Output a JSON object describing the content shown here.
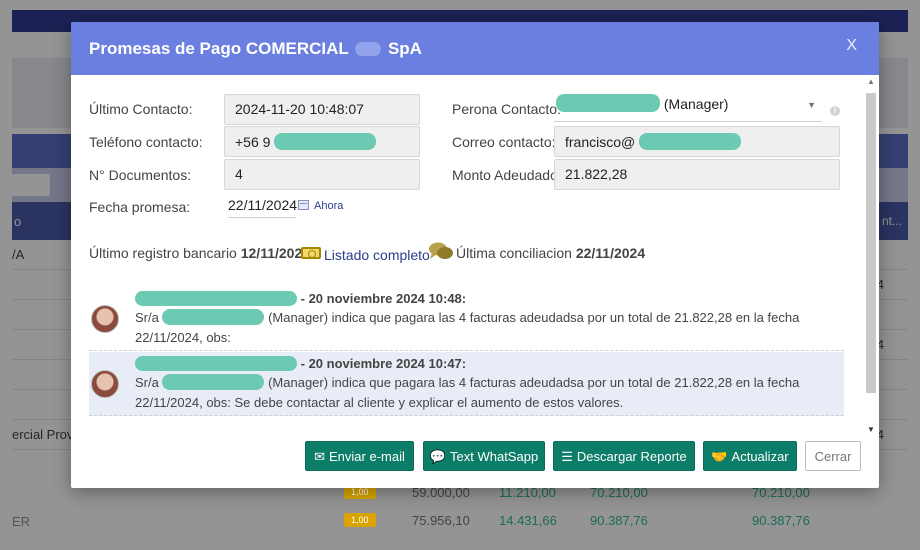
{
  "background": {
    "column_header_left": "o",
    "column_header_right": "nt...",
    "rows": [
      {
        "left": "/A",
        "right": ""
      },
      {
        "left": "",
        "right": "4"
      },
      {
        "left": "",
        "right": ""
      },
      {
        "left": "",
        "right": "4"
      },
      {
        "left": "",
        "right": ""
      },
      {
        "left": "",
        "right": ""
      },
      {
        "left": "ercial Prove",
        "right": "4"
      }
    ],
    "bottom_rows": [
      {
        "label": "",
        "badge": "1,00",
        "c1": "59.000,00",
        "c2": "11.210,00",
        "c3": "70.210,00",
        "c4": "70.210,00"
      },
      {
        "label": "ER",
        "badge": "1,00",
        "c1": "75.956,10",
        "c2": "14.431,66",
        "c3": "90.387,76",
        "c4": "90.387,76"
      }
    ]
  },
  "modal": {
    "title_prefix": "Promesas de Pago COMERCIAL",
    "title_suffix": "SpA",
    "close_label": "X"
  },
  "form": {
    "ultimo_contacto_label": "Último Contacto:",
    "ultimo_contacto_value": "2024-11-20 10:48:07",
    "telefono_label": "Teléfono contacto:",
    "telefono_value_prefix": "+56 9",
    "documentos_label": "N° Documentos:",
    "documentos_value": "4",
    "fecha_promesa_label": "Fecha promesa:",
    "fecha_promesa_value": "22/11/2024",
    "ahora_label": "Ahora",
    "persona_contacto_label": "Perona Contacto:",
    "persona_contacto_role": "(Manager)",
    "correo_label": "Correo contacto:",
    "correo_value_prefix": "francisco@",
    "monto_label": "Monto Adeudado:",
    "monto_value": "21.822,28"
  },
  "info": {
    "registro_label": "Último registro bancario",
    "registro_date": "12/11/2024",
    "listado_label": "Listado completo",
    "conciliacion_label": "Última conciliacion",
    "conciliacion_date": "22/11/2024"
  },
  "comments": [
    {
      "head_suffix": "- 20 noviembre 2024 10:48:",
      "sr_prefix": "Sr/a",
      "body_rest": "(Manager) indica que pagara las 4 facturas adeudadsa por un total de 21.822,28 en la fecha",
      "body_line2": "22/11/2024, obs:"
    },
    {
      "head_suffix": "- 20 noviembre 2024 10:47:",
      "sr_prefix": "Sr/a",
      "body_rest": "(Manager) indica que pagara las 4 facturas adeudadsa por un total de 21.822,28 en la fecha",
      "body_line2": "22/11/2024, obs: Se debe contactar al cliente y explicar el aumento de estos valores."
    }
  ],
  "footer": {
    "email_label": "Enviar e-mail",
    "whatsapp_label": "Text WhatSapp",
    "reporte_label": "Descargar Reporte",
    "actualizar_label": "Actualizar",
    "cerrar_label": "Cerrar"
  },
  "colors": {
    "header": "#6a7fe0",
    "primary_button": "#0c7d68",
    "redaction": "#6cc9b2"
  }
}
